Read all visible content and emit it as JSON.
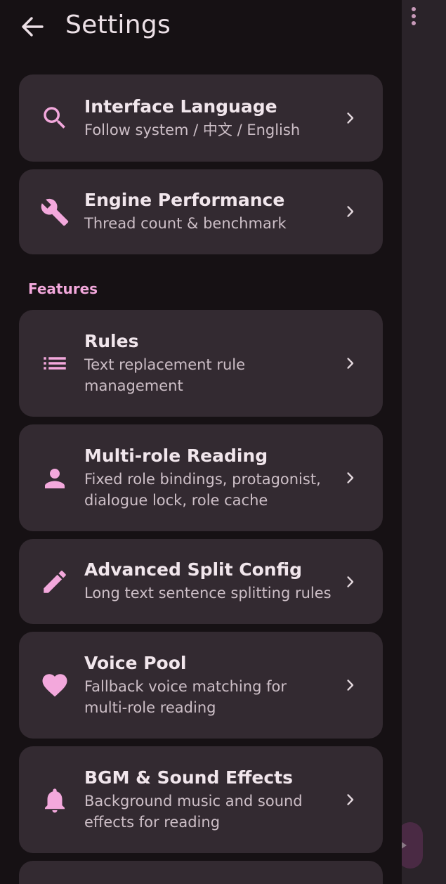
{
  "header": {
    "title": "Settings"
  },
  "sections": {
    "features_label": "Features"
  },
  "items": [
    {
      "id": "interface-language",
      "icon": "search-icon",
      "title": "Interface Language",
      "subtitle": "Follow system / 中文 / English"
    },
    {
      "id": "engine-performance",
      "icon": "wrench-icon",
      "title": "Engine Performance",
      "subtitle": "Thread count & benchmark"
    },
    {
      "id": "rules",
      "icon": "list-icon",
      "title": "Rules",
      "subtitle": "Text replacement rule management"
    },
    {
      "id": "multi-role-reading",
      "icon": "person-icon",
      "title": "Multi-role Reading",
      "subtitle": "Fixed role bindings, protagonist, dialogue lock, role cache"
    },
    {
      "id": "advanced-split-config",
      "icon": "pencil-icon",
      "title": "Advanced Split Config",
      "subtitle": "Long text sentence splitting rules"
    },
    {
      "id": "voice-pool",
      "icon": "heart-icon",
      "title": "Voice Pool",
      "subtitle": "Fallback voice matching for multi-role reading"
    },
    {
      "id": "bgm-sound-effects",
      "icon": "bell-icon",
      "title": "BGM & Sound Effects",
      "subtitle": "Background music and sound effects for reading"
    }
  ],
  "colors": {
    "accent": "#f3a8dc",
    "card_bg": "#332a31",
    "page_bg": "#161114"
  }
}
